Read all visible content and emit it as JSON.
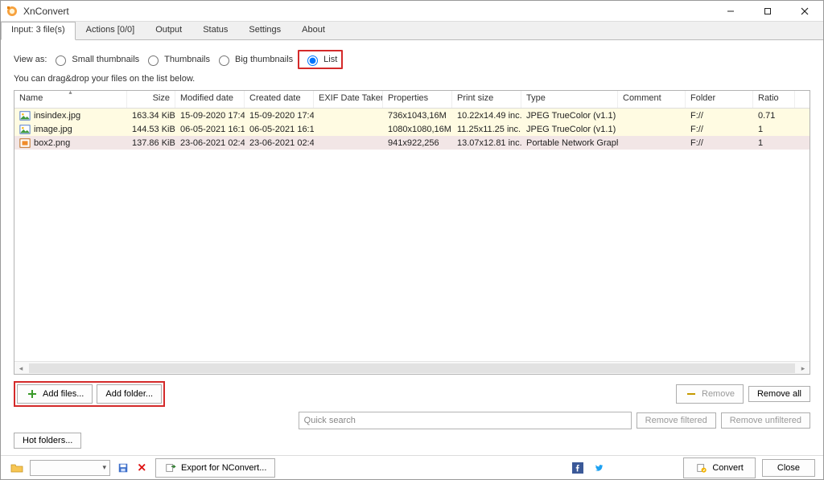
{
  "title": "XnConvert",
  "tabs": [
    "Input: 3 file(s)",
    "Actions [0/0]",
    "Output",
    "Status",
    "Settings",
    "About"
  ],
  "active_tab": 0,
  "viewas": {
    "label": "View as:",
    "options": [
      "Small thumbnails",
      "Thumbnails",
      "Big thumbnails",
      "List"
    ],
    "selected": "List"
  },
  "hint": "You can drag&drop your files on the list below.",
  "columns": [
    "Name",
    "Size",
    "Modified date",
    "Created date",
    "EXIF Date Taken",
    "Properties",
    "Print size",
    "Type",
    "Comment",
    "Folder",
    "Ratio"
  ],
  "rows": [
    {
      "icon": "image",
      "name": "insindex.jpg",
      "size": "163.34 KiB",
      "modified": "15-09-2020 17:4...",
      "created": "15-09-2020 17:4...",
      "exif": "",
      "props": "736x1043,16M",
      "print": "10.22x14.49 inc...",
      "type": "JPEG TrueColor (v1.1)",
      "comment": "",
      "folder": "F://",
      "ratio": "0.71",
      "class": "striped-y"
    },
    {
      "icon": "image",
      "name": "image.jpg",
      "size": "144.53 KiB",
      "modified": "06-05-2021 16:1...",
      "created": "06-05-2021 16:1...",
      "exif": "",
      "props": "1080x1080,16M",
      "print": "11.25x11.25 inc...",
      "type": "JPEG TrueColor (v1.1)",
      "comment": "",
      "folder": "F://",
      "ratio": "1",
      "class": "striped-y"
    },
    {
      "icon": "image-o",
      "name": "box2.png",
      "size": "137.86 KiB",
      "modified": "23-06-2021 02:4...",
      "created": "23-06-2021 02:4...",
      "exif": "",
      "props": "941x922,256",
      "print": "13.07x12.81 inc...",
      "type": "Portable Network Graphics",
      "comment": "",
      "folder": "F://",
      "ratio": "1",
      "class": "selected"
    }
  ],
  "buttons": {
    "add_files": "Add files...",
    "add_folder": "Add folder...",
    "remove": "Remove",
    "remove_all": "Remove all",
    "remove_filtered": "Remove filtered",
    "remove_unfiltered": "Remove unfiltered",
    "hot_folders": "Hot folders...",
    "export": "Export for NConvert...",
    "convert": "Convert",
    "close": "Close"
  },
  "search": {
    "placeholder": "Quick search"
  }
}
